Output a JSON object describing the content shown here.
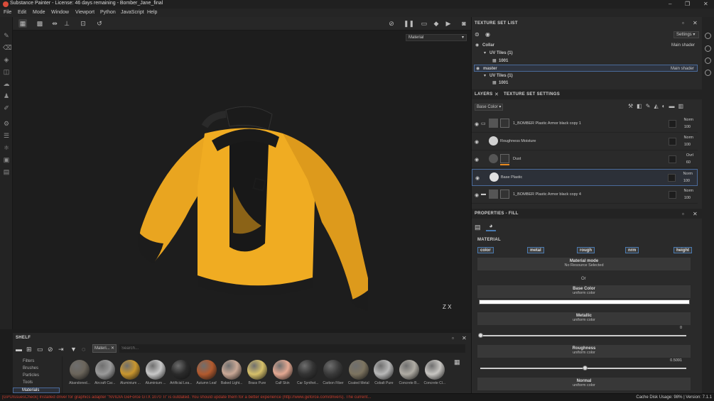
{
  "window": {
    "title": "Substance Painter - License: 46 days remaining - Bomber_Jane_final"
  },
  "menu": [
    "File",
    "Edit",
    "Mode",
    "Window",
    "Viewport",
    "Python",
    "JavaScript",
    "Help"
  ],
  "viewport": {
    "material_select": "Material",
    "gizmo_label": "Z X"
  },
  "texture_set_list": {
    "title": "TEXTURE SET LIST",
    "settings_label": "Settings",
    "sets": [
      {
        "name": "Collar",
        "shader": "Main shader",
        "uv_label": "UV Tiles (1)",
        "tile": "1001"
      },
      {
        "name": "master",
        "shader": "Main shader",
        "uv_label": "UV Tiles (1)",
        "tile": "1001"
      }
    ]
  },
  "layers_panel": {
    "tab_layers": "LAYERS",
    "tab_settings": "TEXTURE SET SETTINGS",
    "channel_select": "Base Color",
    "layers": [
      {
        "name": "1_BOMBER Plastic Armor black copy 1",
        "blend": "Norm",
        "opacity": "100"
      },
      {
        "name": "Roughness Moisture",
        "blend": "Norm",
        "opacity": "100"
      },
      {
        "name": "Dust",
        "blend": "Ovrl",
        "opacity": "60"
      },
      {
        "name": "Base Plastic",
        "blend": "Norm",
        "opacity": "100"
      },
      {
        "name": "1_BOMBER Plastic Armor black copy 4",
        "blend": "Norm",
        "opacity": "100"
      }
    ]
  },
  "properties": {
    "title": "PROPERTIES - FILL",
    "section": "MATERIAL",
    "channels": [
      "color",
      "metal",
      "rough",
      "nrm",
      "height"
    ],
    "material_mode": {
      "title": "Material mode",
      "sub": "No Resource Selected"
    },
    "or_label": "Or",
    "base_color": {
      "title": "Base Color",
      "sub": "uniform color"
    },
    "metallic": {
      "title": "Metallic",
      "sub": "uniform color",
      "value": "0",
      "fraction": 0.0
    },
    "roughness": {
      "title": "Roughness",
      "sub": "uniform color",
      "value": "0.5091",
      "fraction": 0.5091
    },
    "normal": {
      "title": "Normal",
      "sub": "uniform color"
    }
  },
  "shelf": {
    "title": "SHELF",
    "filter_tag": "Materi...",
    "search_placeholder": "Search...",
    "categories": [
      "Filters",
      "Brushes",
      "Particles",
      "Tools",
      "Materials"
    ],
    "materials": [
      {
        "name": "Abandoned...",
        "color": "#6b655b"
      },
      {
        "name": "Aircraft Car...",
        "color": "#9a9a9a"
      },
      {
        "name": "Aluminium ...",
        "color": "#c9962e"
      },
      {
        "name": "Aluminium ...",
        "color": "#c8c8c8"
      },
      {
        "name": "Artificial Lea...",
        "color": "#2a2a2a"
      },
      {
        "name": "Autumn Leaf",
        "color": "#b25a2e"
      },
      {
        "name": "Baked Light...",
        "color": "#c9a896"
      },
      {
        "name": "Brass Pure",
        "color": "#d6c06a"
      },
      {
        "name": "Calf Skin",
        "color": "#e3a892"
      },
      {
        "name": "Car Synthet...",
        "color": "#333333"
      },
      {
        "name": "Carbon Fiber",
        "color": "#3a3a3a"
      },
      {
        "name": "Coated Metal",
        "color": "#7d7460"
      },
      {
        "name": "Cobalt Pure",
        "color": "#b8b8b8"
      },
      {
        "name": "Concrete B...",
        "color": "#b0aca4"
      },
      {
        "name": "Concrete Cl...",
        "color": "#c8c6c2"
      }
    ]
  },
  "status": {
    "warning": "[GPUIssuesCheck] Installed driver for graphics adapter \"NVIDIA GeForce GTX 1070 Ti\" is outdated. You should update them for a better experience (http://www.geforce.com/drivers). The current...",
    "cache": "Cache Disk Usage:  98%  |  Version: 7.1.1"
  }
}
